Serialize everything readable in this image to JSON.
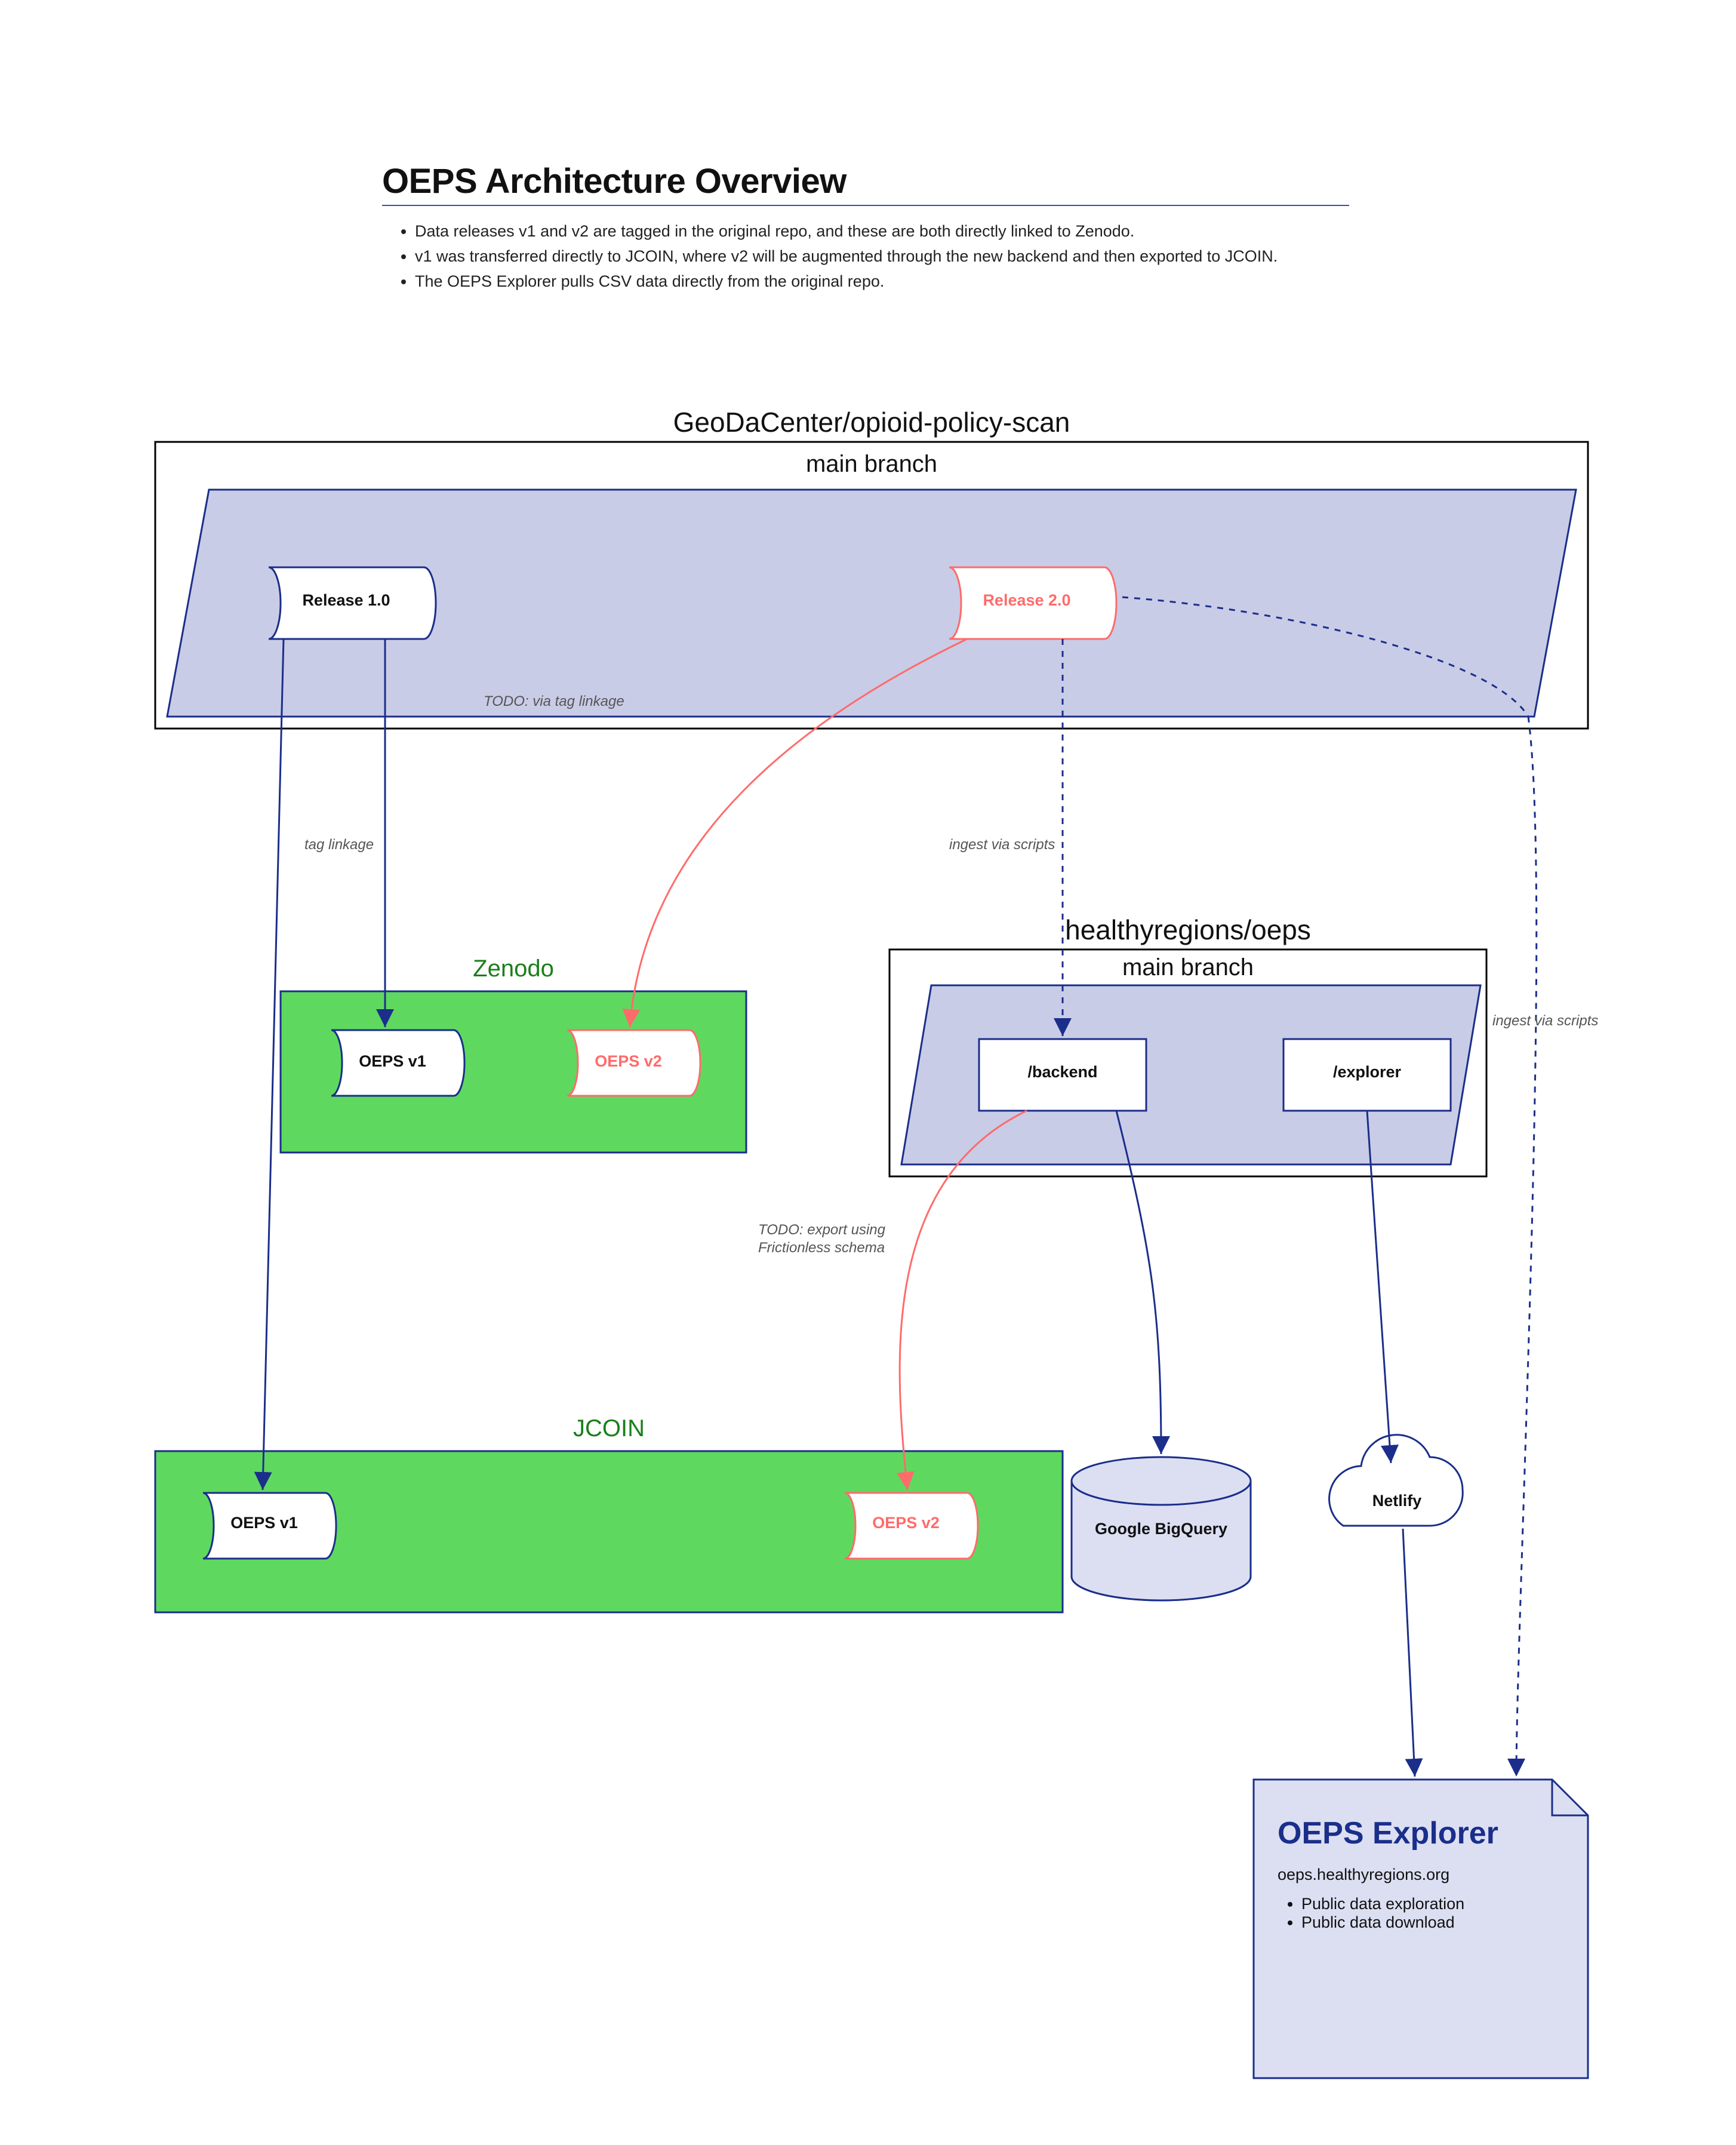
{
  "page": {
    "title": "OEPS Architecture Overview",
    "bullets": [
      "Data releases v1 and v2 are tagged in the original repo, and these are both directly linked to Zenodo.",
      "v1 was transferred directly to JCOIN, where v2 will be augmented through the new backend and then exported to JCOIN.",
      "The OEPS Explorer pulls CSV data directly from the original repo."
    ]
  },
  "repos": {
    "geodacenter": {
      "title": "GeoDaCenter/opioid-policy-scan",
      "branch": "main branch",
      "releases": {
        "r1": "Release 1.0",
        "r2": "Release 2.0"
      }
    },
    "healthyregions": {
      "title": "healthyregions/oeps",
      "branch": "main branch",
      "dirs": {
        "backend": "/backend",
        "explorer": "/explorer"
      }
    }
  },
  "zenodo": {
    "title": "Zenodo",
    "v1": "OEPS v1",
    "v2": "OEPS v2"
  },
  "jcoin": {
    "title": "JCOIN",
    "v1": "OEPS v1",
    "v2": "OEPS v2"
  },
  "services": {
    "bigquery": "Google BigQuery",
    "netlify": "Netlify"
  },
  "explorer": {
    "title": "OEPS Explorer",
    "url": "oeps.healthyregions.org",
    "bullets": [
      "Public data exploration",
      "Public data download"
    ]
  },
  "edges": {
    "tag_linkage": "tag linkage",
    "todo_tag_linkage": "TODO: via tag linkage",
    "ingest_scripts": "ingest via scripts",
    "ingest_scripts2": "ingest via scripts",
    "todo_export": "TODO: export using\nFrictionless schema"
  }
}
